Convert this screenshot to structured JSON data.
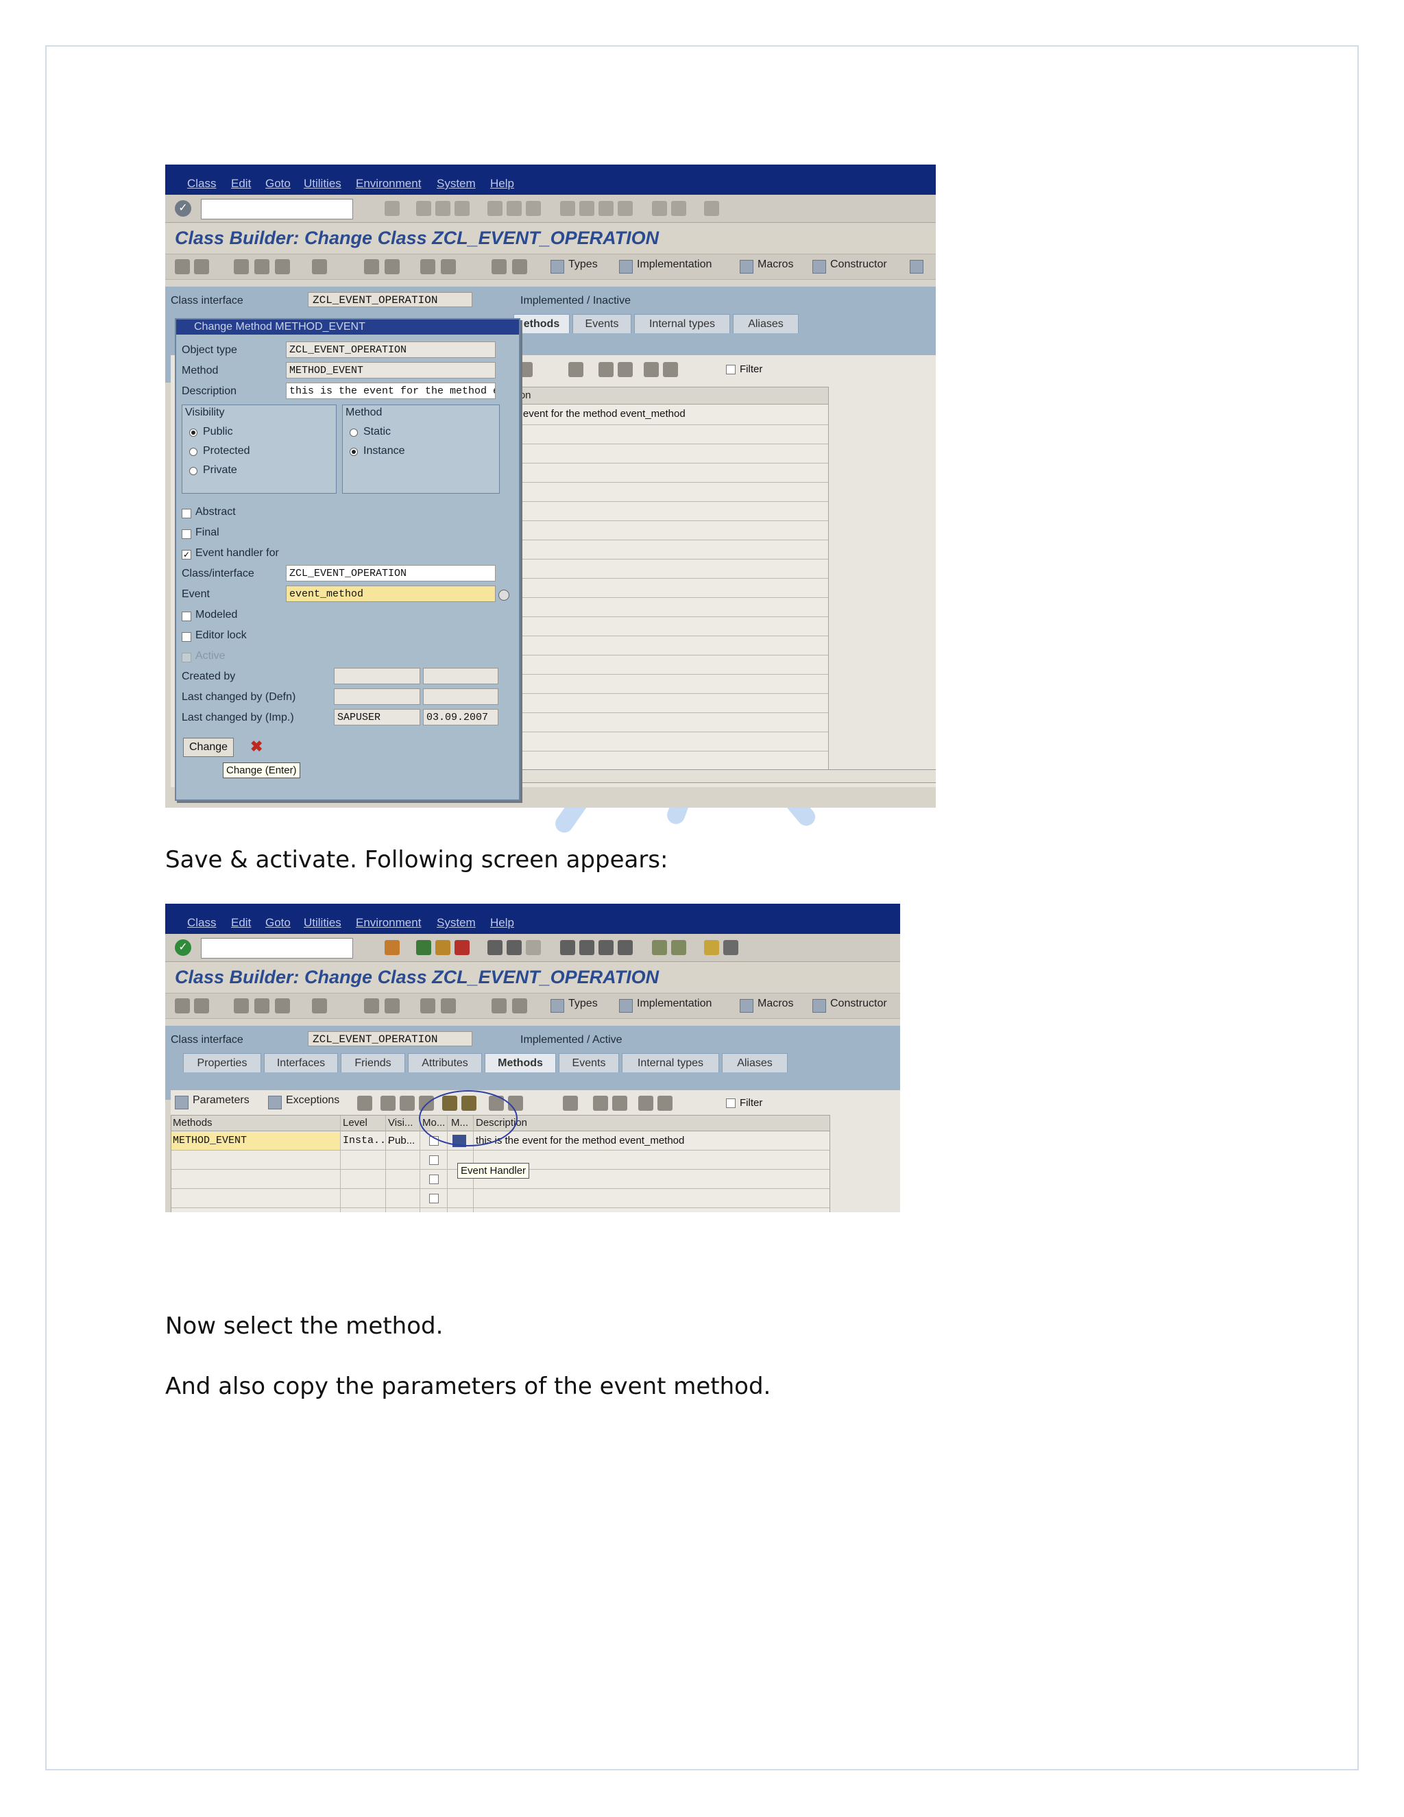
{
  "captions": {
    "after_first_screenshot": "Save & activate. Following screen appears:",
    "select_method": "Now select the method.",
    "copy_parameters": "And also copy the parameters of the event method."
  },
  "sap": {
    "menu": [
      "Class",
      "Edit",
      "Goto",
      "Utilities",
      "Environment",
      "System",
      "Help"
    ],
    "title": "Class Builder: Change Class ZCL_EVENT_OPERATION",
    "toolbar_buttons": {
      "types": "Types",
      "implementation": "Implementation",
      "macros": "Macros",
      "constructor": "Constructor"
    },
    "class_interface_label": "Class interface",
    "class_name": "ZCL_EVENT_OPERATION",
    "tabs": [
      "Properties",
      "Interfaces",
      "Friends",
      "Attributes",
      "Methods",
      "Events",
      "Internal types",
      "Aliases"
    ],
    "filter_label": "Filter"
  },
  "screen1": {
    "status": "Implemented / Inactive",
    "tab_methods_partial": "ethods",
    "description_header_partial": "ption",
    "row_description_partial": "he event for the method event_method",
    "dialog": {
      "title": "Change Method METHOD_EVENT",
      "object_type_label": "Object type",
      "object_type": "ZCL_EVENT_OPERATION",
      "method_label": "Method",
      "method": "METHOD_EVENT",
      "description_label": "Description",
      "description": "this is the event for the method event...",
      "visibility_label": "Visibility",
      "visibility_options": [
        "Public",
        "Protected",
        "Private"
      ],
      "method_group_label": "Method",
      "method_options": [
        "Static",
        "Instance"
      ],
      "abstract_label": "Abstract",
      "final_label": "Final",
      "event_handler_label": "Event handler for",
      "class_interface_label": "Class/interface",
      "class_interface": "ZCL_EVENT_OPERATION",
      "event_label": "Event",
      "event": "event_method",
      "modeled_label": "Modeled",
      "editor_lock_label": "Editor lock",
      "active_label": "Active",
      "created_by_label": "Created by",
      "last_changed_defn_label": "Last changed by (Defn)",
      "last_changed_imp_label": "Last changed by (Imp.)",
      "last_changed_imp_user": "SAPUSER",
      "last_changed_imp_date": "03.09.2007",
      "change_button": "Change",
      "tooltip": "Change  (Enter)"
    }
  },
  "screen2": {
    "status": "Implemented / Active",
    "subtoolbar": {
      "parameters": "Parameters",
      "exceptions": "Exceptions"
    },
    "columns": [
      "Methods",
      "Level",
      "Visi...",
      "Mo...",
      "M...",
      "Description"
    ],
    "row": {
      "method": "METHOD_EVENT",
      "level": "Insta...",
      "visibility": "Pub...",
      "description": "this is the event for the method event_method"
    },
    "tooltip": "Event Handler"
  }
}
